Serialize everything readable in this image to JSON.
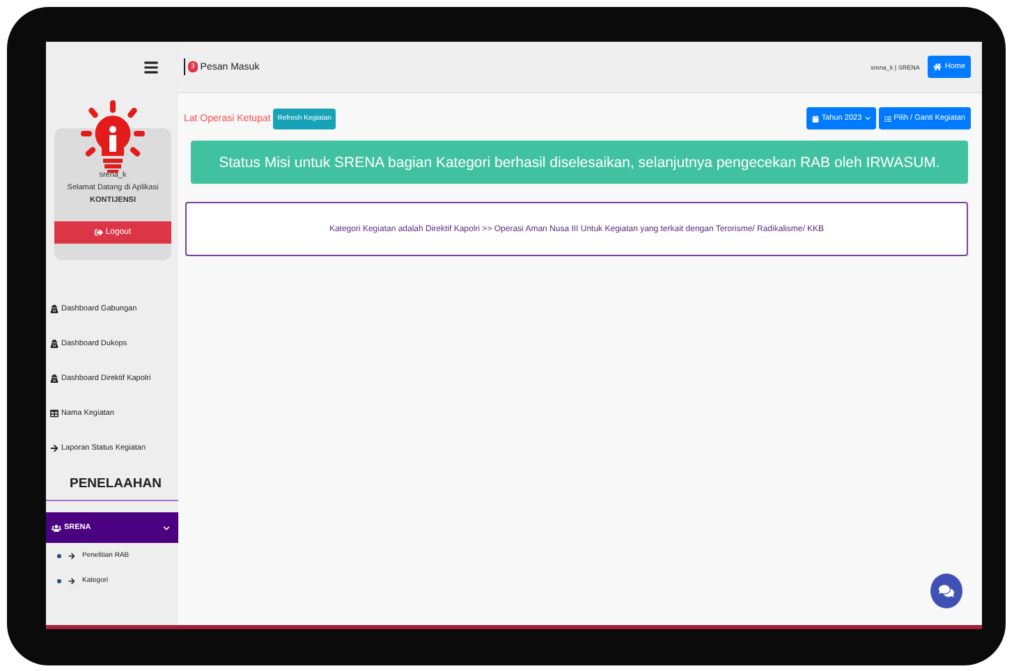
{
  "topbar": {
    "badge": "3",
    "title": "Pesan Masuk",
    "user": "srena_k | SRENA",
    "home": "Home"
  },
  "sidebar": {
    "username": "srena_k",
    "welcome": "Selamat Datang di Aplikasi",
    "app": "KONTIJENSI",
    "logout": "Logout",
    "items": [
      {
        "label": "Dashboard Gabungan",
        "kind": "dashboard"
      },
      {
        "label": "Dashboard Dukops",
        "kind": "dashboard"
      },
      {
        "label": "Dashboard Direktif Kapolri",
        "kind": "dashboard"
      },
      {
        "label": "Nama Kegiatan",
        "kind": "table"
      },
      {
        "label": "Laporan Status Kegiatan",
        "kind": "arrow"
      }
    ],
    "section": "PENELAAHAN",
    "group": {
      "label": "SRENA",
      "selected": true,
      "expanded": true,
      "children": [
        {
          "label": "Penelitian RAB"
        },
        {
          "label": "Kategori"
        }
      ]
    }
  },
  "toolbar": {
    "operation": "Lat Operasi Ketupat",
    "refresh": "Refresh Kegiatan",
    "year": "Tahun 2023",
    "choose": "Pilih / Ganti Kegiatan"
  },
  "alert": "Status Misi untuk SRENA bagian Kategori berhasil diselesaikan, selanjutnya pengecekan RAB oleh IRWASUM.",
  "info": "Kategori Kegiatan adalah Direktif Kapolri >> Operasi Aman Nusa III Untuk Kegiatan yang terkait dengan Terorisme/ Radikalisme/ KKB"
}
